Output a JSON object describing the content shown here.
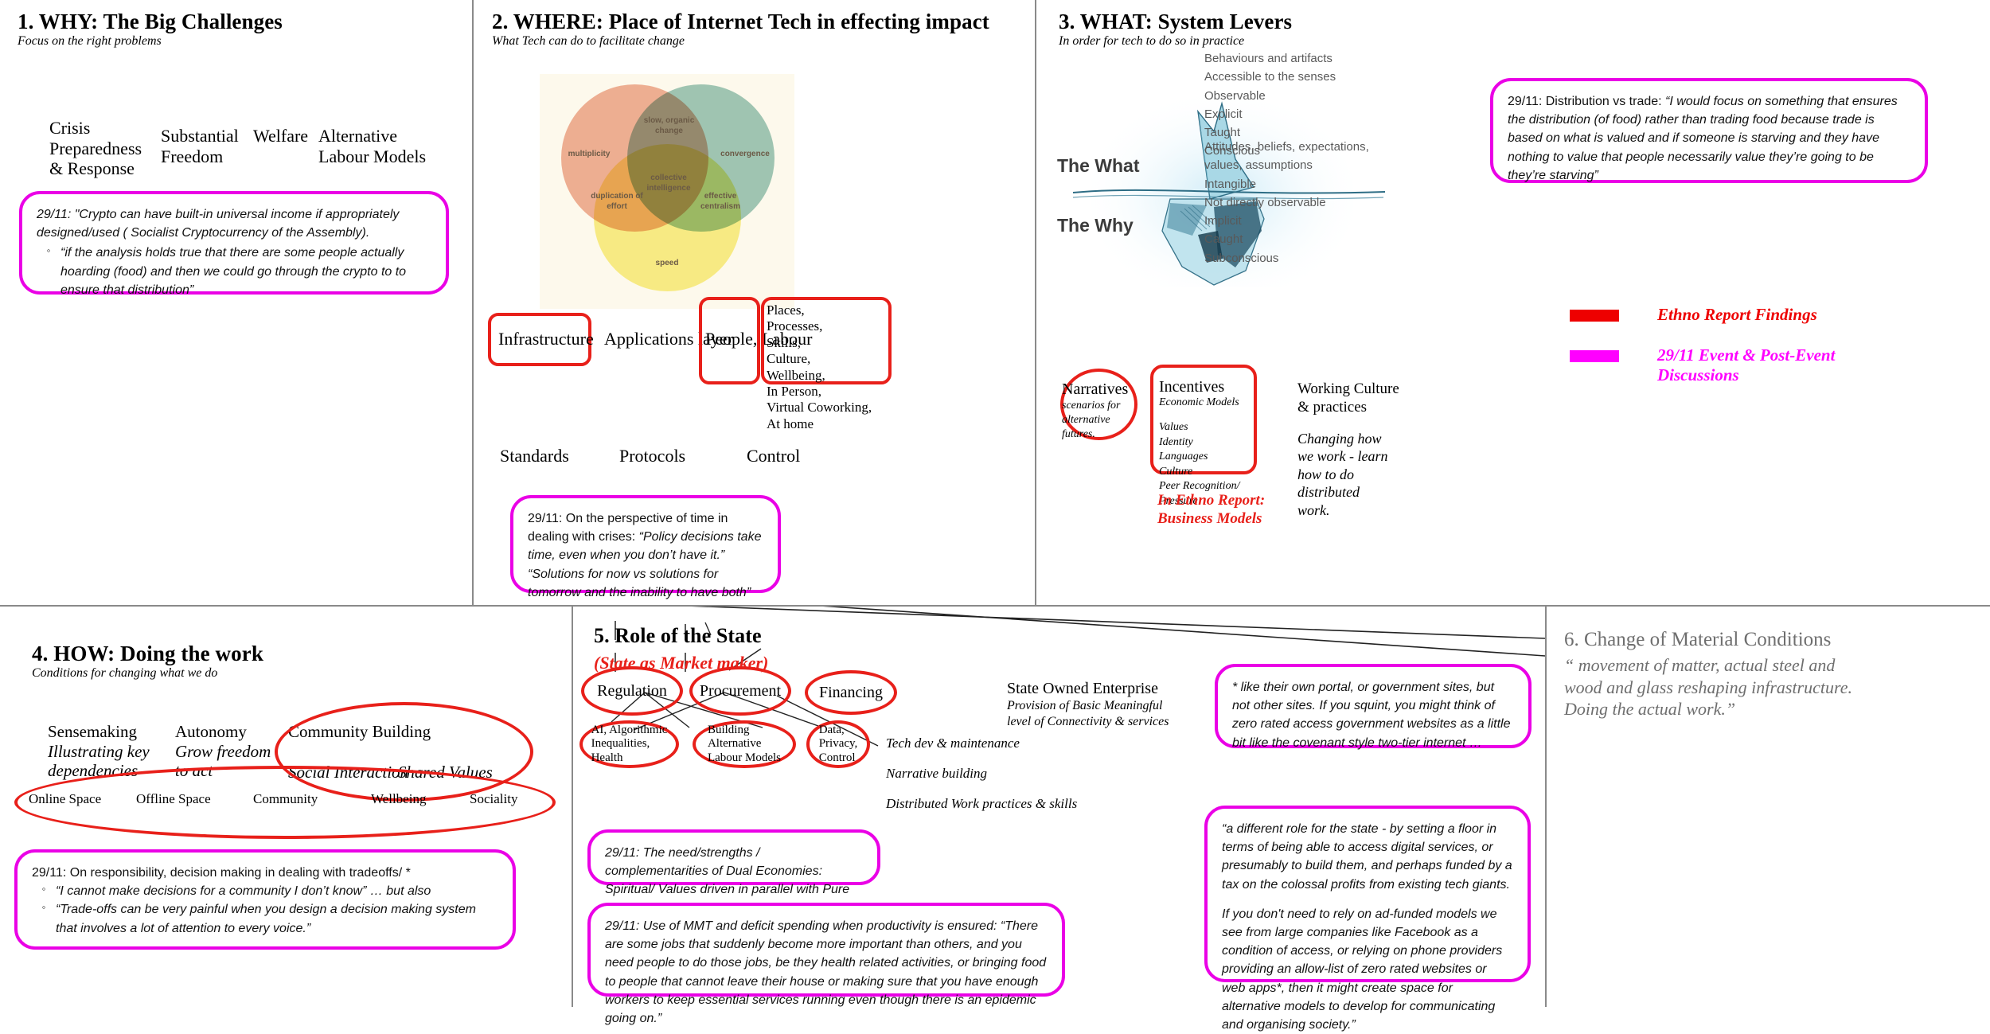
{
  "legend": {
    "items": [
      {
        "color": "#ee0000",
        "label": "Ethno Report Findings"
      },
      {
        "color": "#ff00ff",
        "label": "29/11  Event & Post-Event Discussions"
      }
    ]
  },
  "panel1": {
    "title": "1. WHY: The Big Challenges",
    "subtitle": "Focus on the right problems",
    "keywords": [
      "Crisis\nPreparedness\n& Response",
      "Substantial\nFreedom",
      "Welfare",
      "Alternative\nLabour Models"
    ],
    "note": {
      "lead": "29/11: \"Crypto can have built-in universal income if appropriately designed/used ( Socialist Cryptocurrency of the Assembly).",
      "bullets": [
        "“if the analysis holds true that there are some people actually hoarding (food) and then we could go through the crypto to to ensure that distribution”"
      ]
    }
  },
  "panel2": {
    "title": "2. WHERE: Place of Internet Tech in effecting impact",
    "subtitle": "What Tech can do to facilitate change",
    "venn": {
      "circles": [
        {
          "name": "multiplicity",
          "color": "#eda58c"
        },
        {
          "name": "convergence",
          "color": "#8fc0b4"
        },
        {
          "name": "speed",
          "color": "#f8ee7a"
        }
      ],
      "overlaps": [
        "slow, organic change",
        "collective intelligence",
        "duplication of effort",
        "effective centralism"
      ]
    },
    "layers": [
      "Infrastructure",
      "Applications layer",
      "People, Labour"
    ],
    "detail_list": "Places,\nProcesses,\nSkills,\nCulture,\nWellbeing,\nIn Person,\nVirtual Coworking,\nAt home",
    "sublabels": [
      "Standards",
      "Protocols",
      "Control"
    ],
    "note": {
      "lead": "29/11: On the perspective of time in dealing with crises: ",
      "quote": "“Policy decisions take time, even when you don’t have it.” “Solutions for now vs solutions for tomorrow and the inability to have both”"
    }
  },
  "panel3": {
    "title": "3. WHAT: System Levers",
    "subtitle": "In order for tech to do so in practice",
    "iceberg": {
      "top_label": "The What",
      "bottom_label": "The Why",
      "top_list": [
        "Behaviours and artifacts",
        "Accessible to the senses",
        "Observable",
        "Explicit",
        "Taught",
        "Conscious"
      ],
      "bottom_list": [
        "Attitudes, beliefs, expectations,",
        "values, assumptions",
        "Intangible",
        "Not directly observable",
        "Implicit",
        "Caught",
        "Subconscious"
      ]
    },
    "note": {
      "lead": "29/11: Distribution vs trade: ",
      "quote": "“I would focus on something that ensures the distribution (of food) rather than trading food because trade is based on what is valued and if someone is starving and they have nothing to value that people necessarily value they’re going to be they’re starving”"
    },
    "narratives": {
      "title": "Narratives",
      "body": "scenarios for\nalternative\nfutures."
    },
    "incentives": {
      "title": "Incentives",
      "subtitle": "Economic Models",
      "items": [
        "Values",
        "Identity",
        "Languages",
        "Culture",
        "Peer Recognition/",
        "Pressure"
      ]
    },
    "working_culture": {
      "title": "Working Culture\n& practices",
      "body": "Changing how\nwe work - learn\nhow to do\ndistributed\nwork."
    },
    "ethno_tag": "In  Ethno Report:\nBusiness Models"
  },
  "panel4": {
    "title": "4. HOW: Doing the work",
    "subtitle": "Conditions for changing what we do",
    "columns": [
      {
        "head": "Sensemaking",
        "sub": "Illustrating key\ndependencies"
      },
      {
        "head": "Autonomy",
        "sub": "Grow freedom\nto act"
      },
      {
        "head": "Community Building",
        "sub": ""
      }
    ],
    "community_items": [
      "Social Interaction",
      "Shared Values"
    ],
    "spaces": [
      "Online Space",
      "Offline Space",
      "Community",
      "Wellbeing",
      "Sociality"
    ],
    "note": {
      "lead": "29/11: On responsibility, decision making in dealing with tradeoffs/ *",
      "bullets": [
        "“I cannot make decisions for a community I don’t know” … but also",
        "“Trade-offs can be very painful when you design a decision making system that involves a lot of attention to every voice.”"
      ]
    }
  },
  "panel5": {
    "title": "5. Role of the State",
    "redtitle": "(State as Market maker)",
    "ovals_top": [
      "Regulation",
      "Procurement",
      "Financing"
    ],
    "ovals_bottom": [
      "AI, Algorithmic\nInequalities,\nHealth",
      "Building\nAlternative\nLabour Models",
      "Data,\nPrivacy,\nControl"
    ],
    "side_items": [
      "Tech dev & maintenance",
      "Narrative building",
      "Distributed Work practices & skills"
    ],
    "soe": {
      "title": "State Owned Enterprise",
      "sub": "Provision of Basic Meaningful\nlevel of  Connectivity & services"
    },
    "note1": "29/11: The need/strengths / complementarities of Dual Economies: Spiritual/ Values driven in parallel with Pure Commerce",
    "note2": {
      "lead": "29/11: Use of MMT and deficit spending when productivity is ensured: ",
      "quote": "“There are some jobs that suddenly become more important than others, and you need people to do those jobs, be they health related activities, or bringing food to people that cannot leave their house or making sure that you have enough workers to keep essential services running even though there is an epidemic going on.”"
    },
    "note3": "* like their own portal, or government sites, but not other sites. If you squint, you might think of zero rated access government websites as a little bit like the covenant style two-tier internet …",
    "note4": {
      "p1": "“a different role for the state - by setting a floor in terms of being able to access digital services, or presumably to build them, and perhaps funded by a tax on the colossal profits from existing tech giants.",
      "p2": "If you don't need to rely on ad-funded models we see from large companies like Facebook as a condition of access, or relying on phone providers providing an allow-list of zero rated websites or web apps*, then it might create space for alternative models to develop for communicating and organising society.”"
    }
  },
  "panel6": {
    "title": "6. Change of Material Conditions",
    "subtitle": "“ movement of matter, actual steel and wood and glass reshaping infrastructure. Doing the actual work.”"
  }
}
